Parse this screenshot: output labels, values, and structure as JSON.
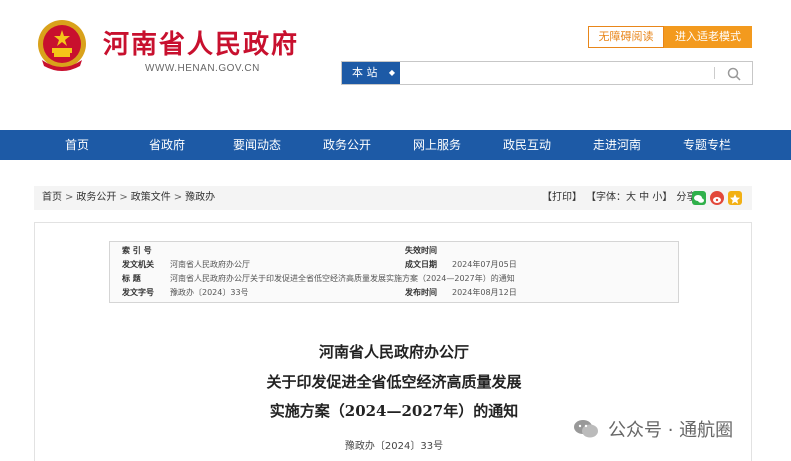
{
  "header": {
    "site_title": "河南省人民政府",
    "site_domain": "WWW.HENAN.GOV.CN",
    "accessibility_label": "无障碍阅读",
    "elder_mode_label": "进入适老模式"
  },
  "search": {
    "scope": "本 站",
    "placeholder": ""
  },
  "nav": {
    "items": [
      "首页",
      "省政府",
      "要闻动态",
      "政务公开",
      "网上服务",
      "政民互动",
      "走进河南",
      "专题专栏"
    ]
  },
  "breadcrumb": {
    "items": [
      "首页",
      "政务公开",
      "政策文件",
      "豫政办"
    ],
    "separator": ">"
  },
  "tools": {
    "print": "【打印】",
    "font_size": "【字体：大 中 小】",
    "share": "分享："
  },
  "meta": {
    "index_label": "索 引 号",
    "index_value": "",
    "expire_label": "失效时间",
    "expire_value": "",
    "issuer_label": "发文机关",
    "issuer_value": "河南省人民政府办公厅",
    "date_label": "成文日期",
    "date_value": "2024年07月05日",
    "title_label": "标      题",
    "title_value": "河南省人民政府办公厅关于印发促进全省低空经济高质量发展实施方案（2024—2027年）的通知",
    "docno_label": "发文字号",
    "docno_value": "豫政办〔2024〕33号",
    "publish_label": "发布时间",
    "publish_value": "2024年08月12日"
  },
  "article": {
    "title_line1": "河南省人民政府办公厅",
    "title_line2": "关于印发促进全省低空经济高质量发展",
    "title_line3": "实施方案（2024—2027年）的通知",
    "doc_number": "豫政办〔2024〕33号"
  },
  "watermark": {
    "text": "公众号 · 通航圈"
  },
  "colors": {
    "brand_red": "#c8102e",
    "nav_blue": "#1d5aa6",
    "accent_orange": "#f39a1e"
  }
}
